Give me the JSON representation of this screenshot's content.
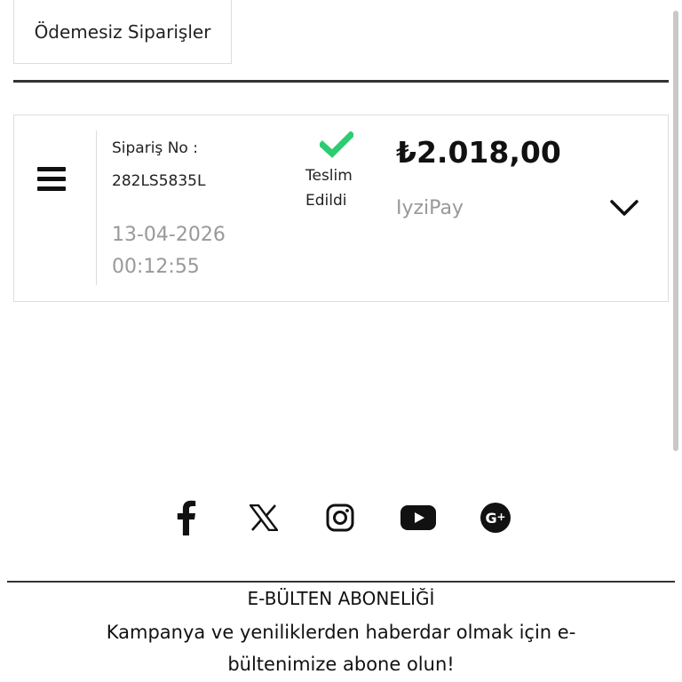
{
  "tabs": {
    "unpaid_orders_label": "Ödemesiz Siparişler"
  },
  "order": {
    "order_no_label": "Sipariş No :",
    "order_no": "282LS5835L",
    "date": "13-04-2026",
    "time": "00:12:55",
    "status": "Teslim Edildi",
    "status_color": "#2ecc71",
    "price": "₺2.018,00",
    "payment_method": "IyziPay"
  },
  "social": {
    "icons": [
      "facebook-icon",
      "x-twitter-icon",
      "instagram-icon",
      "youtube-icon",
      "google-plus-icon"
    ]
  },
  "newsletter": {
    "title": "E-BÜLTEN ABONELİĞİ",
    "description": "Kampanya ve yeniliklerden haberdar olmak için e-bültenimize abone olun!"
  }
}
